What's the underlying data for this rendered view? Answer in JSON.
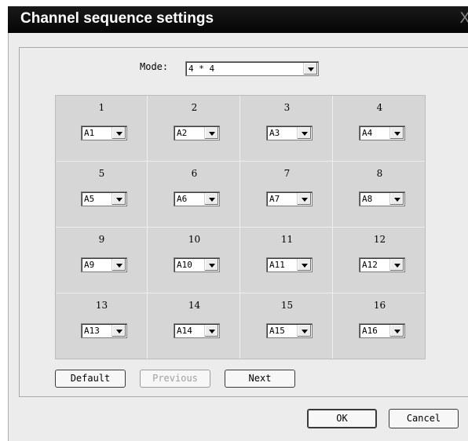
{
  "window": {
    "title": "Channel sequence settings",
    "close_glyph": "X"
  },
  "mode": {
    "label": "Mode:",
    "value": "4 * 4"
  },
  "cells": [
    {
      "number": "1",
      "channel": "A1"
    },
    {
      "number": "2",
      "channel": "A2"
    },
    {
      "number": "3",
      "channel": "A3"
    },
    {
      "number": "4",
      "channel": "A4"
    },
    {
      "number": "5",
      "channel": "A5"
    },
    {
      "number": "6",
      "channel": "A6"
    },
    {
      "number": "7",
      "channel": "A7"
    },
    {
      "number": "8",
      "channel": "A8"
    },
    {
      "number": "9",
      "channel": "A9"
    },
    {
      "number": "10",
      "channel": "A10"
    },
    {
      "number": "11",
      "channel": "A11"
    },
    {
      "number": "12",
      "channel": "A12"
    },
    {
      "number": "13",
      "channel": "A13"
    },
    {
      "number": "14",
      "channel": "A14"
    },
    {
      "number": "15",
      "channel": "A15"
    },
    {
      "number": "16",
      "channel": "A16"
    }
  ],
  "buttons": {
    "default_label": "Default",
    "previous_label": "Previous",
    "next_label": "Next",
    "ok_label": "OK",
    "cancel_label": "Cancel"
  }
}
